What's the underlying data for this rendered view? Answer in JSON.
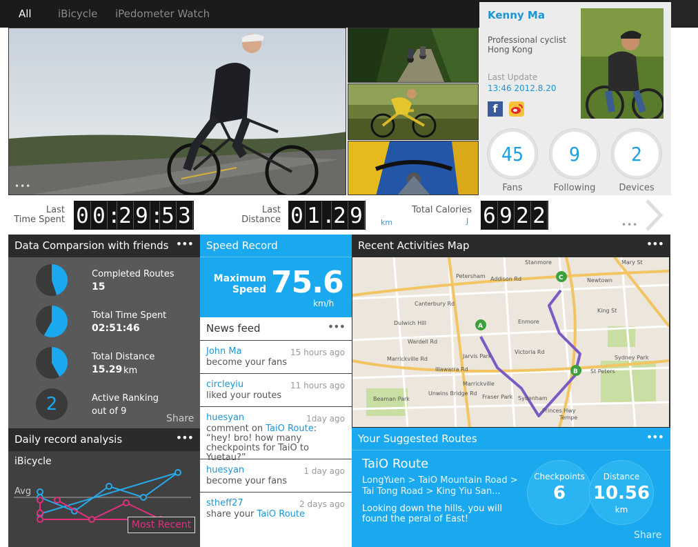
{
  "tabs": [
    {
      "label": "All",
      "active": true
    },
    {
      "label": "iBicycle",
      "active": false
    },
    {
      "label": "iPedometer Watch",
      "active": false
    }
  ],
  "profile": {
    "name": "Kenny Ma",
    "title": "Professional cyclist",
    "location": "Hong Kong",
    "last_update_label": "Last Update",
    "last_update": "13:46 2012.8.20",
    "social": [
      "facebook-icon",
      "weibo-icon"
    ],
    "counts": [
      {
        "value": "45",
        "label": "Fans"
      },
      {
        "value": "9",
        "label": "Following"
      },
      {
        "value": "2",
        "label": "Devices"
      }
    ]
  },
  "stats": {
    "time": {
      "label1": "Last",
      "label2": "Time Spent",
      "digits": [
        "0",
        "0",
        ":",
        "2",
        "9",
        ":",
        "5",
        "3"
      ]
    },
    "distance": {
      "label1": "Last",
      "label2": "Distance",
      "digits": [
        "0",
        "1",
        ".",
        "2",
        "9"
      ],
      "unit": "km"
    },
    "calories": {
      "label1": "Total Calories",
      "digits": [
        "6",
        "9",
        "2",
        "2"
      ],
      "unit": "J"
    }
  },
  "data_comparison": {
    "title": "Data Comparsion with friends",
    "items": [
      {
        "label": "Completed Routes",
        "value": "15",
        "fraction": 0.45
      },
      {
        "label": "Total Time Spent",
        "value": "02:51:46",
        "fraction": 0.58
      },
      {
        "label": "Total Distance",
        "value": "15.29",
        "unit": "km",
        "fraction": 0.42
      },
      {
        "label": "Active Ranking",
        "value": "2",
        "sub": "out of 9"
      }
    ],
    "share": "Share"
  },
  "daily": {
    "title": "Daily record analysis",
    "device": "iBicycle",
    "avg_label": "Avg",
    "legend": "Most Recent",
    "blue_series": [
      0.5,
      0.75,
      0.3,
      0.5,
      0.05,
      0.8,
      0.4
    ],
    "pink_series": [
      0.55,
      0.9,
      0.6,
      0.9,
      0.9,
      0.55,
      0.78
    ]
  },
  "speed": {
    "title": "Speed Record",
    "label1": "Maximum",
    "label2": "Speed",
    "value": "75.6",
    "unit": "km/h"
  },
  "news": {
    "title": "News feed",
    "items": [
      {
        "name": "John Ma",
        "time": "15 hours ago",
        "text": "become your fans"
      },
      {
        "name": "circleyiu",
        "time": "11 hours ago",
        "text": "liked your routes"
      },
      {
        "name": "huesyan",
        "time": "1day ago",
        "pre": "comment on ",
        "link": "TaiO Route",
        "post": ":",
        "text2": "“hey! bro! how many checkpoints for TaiO to Yuetau?”"
      },
      {
        "name": "huesyan",
        "time": "1 day ago",
        "text": "become your fans"
      },
      {
        "name": "stheff27",
        "time": "2 days ago",
        "pre": "share your ",
        "link": "TaiO Route"
      }
    ]
  },
  "map": {
    "title": "Recent Activities Map",
    "labels": [
      "Petersham",
      "Stanmore",
      "Newtown",
      "Dulwich Hill",
      "Enmore",
      "Marrickville",
      "Jarvis Park",
      "St Peters",
      "Sydney Park",
      "Fraser Park",
      "Sydenham",
      "Tempe",
      "Beaman Park",
      "Marrickville Rd",
      "Victoria Rd",
      "Addison Rd",
      "Wardell Rd",
      "Illawarra Rd",
      "Canterbury Rd",
      "King St",
      "Mary St",
      "Unwins Bridge Rd",
      "Princes Hwy"
    ],
    "markers": [
      "A",
      "B",
      "C"
    ]
  },
  "routes": {
    "title": "Your Suggested Routes",
    "name": "TaiO Route",
    "path1": "LongYuen > TaiO Mountain Road >",
    "path2": "Tai Tong Road > King Yiu San...",
    "desc": "Looking down the hills, you will found the peral of East!",
    "checkpoints_label": "Checkpoints",
    "checkpoints": "6",
    "distance_label": "Distance",
    "distance": "10.56",
    "distance_unit": "km",
    "share": "Share"
  },
  "colors": {
    "accent": "#1aa9ee",
    "pink": "#e0307e",
    "dark": "#2b2b2b",
    "gray": "#595959"
  }
}
